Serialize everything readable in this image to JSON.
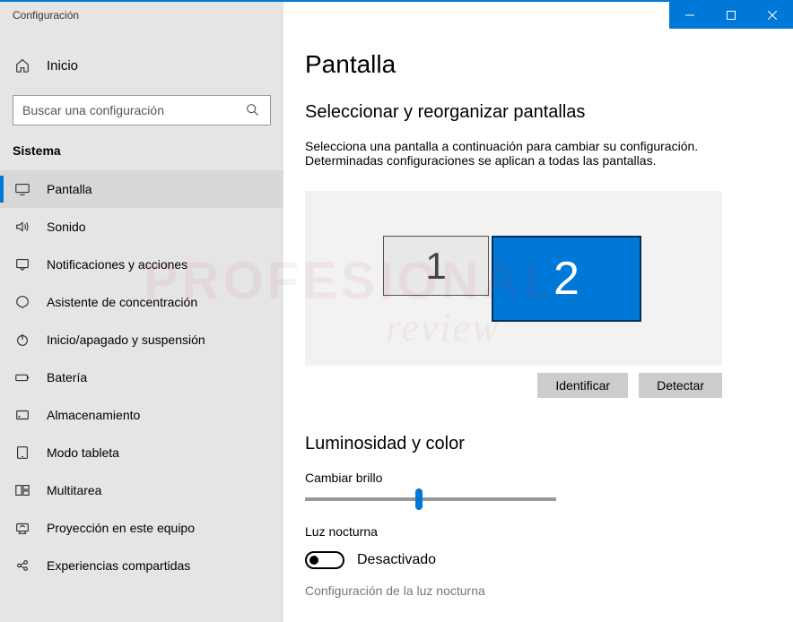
{
  "window": {
    "title": "Configuración"
  },
  "sidebar": {
    "home": "Inicio",
    "search_placeholder": "Buscar una configuración",
    "section": "Sistema",
    "items": [
      {
        "label": "Pantalla",
        "icon": "display-icon",
        "active": true
      },
      {
        "label": "Sonido",
        "icon": "sound-icon"
      },
      {
        "label": "Notificaciones y acciones",
        "icon": "notifications-icon"
      },
      {
        "label": "Asistente de concentración",
        "icon": "focus-icon"
      },
      {
        "label": "Inicio/apagado y suspensión",
        "icon": "power-icon"
      },
      {
        "label": "Batería",
        "icon": "battery-icon"
      },
      {
        "label": "Almacenamiento",
        "icon": "storage-icon"
      },
      {
        "label": "Modo tableta",
        "icon": "tablet-icon"
      },
      {
        "label": "Multitarea",
        "icon": "multitask-icon"
      },
      {
        "label": "Proyección en este equipo",
        "icon": "project-icon"
      },
      {
        "label": "Experiencias compartidas",
        "icon": "shared-icon"
      }
    ]
  },
  "main": {
    "title": "Pantalla",
    "arrange_heading": "Seleccionar y reorganizar pantallas",
    "arrange_desc": "Selecciona una pantalla a continuación para cambiar su configuración. Determinadas configuraciones se aplican a todas las pantallas.",
    "monitors": {
      "m1": "1",
      "m2": "2"
    },
    "identify_btn": "Identificar",
    "detect_btn": "Detectar",
    "brightness_heading": "Luminosidad y color",
    "brightness_label": "Cambiar brillo",
    "nightlight_label": "Luz nocturna",
    "nightlight_state": "Desactivado",
    "nightlight_link": "Configuración de la luz nocturna"
  }
}
